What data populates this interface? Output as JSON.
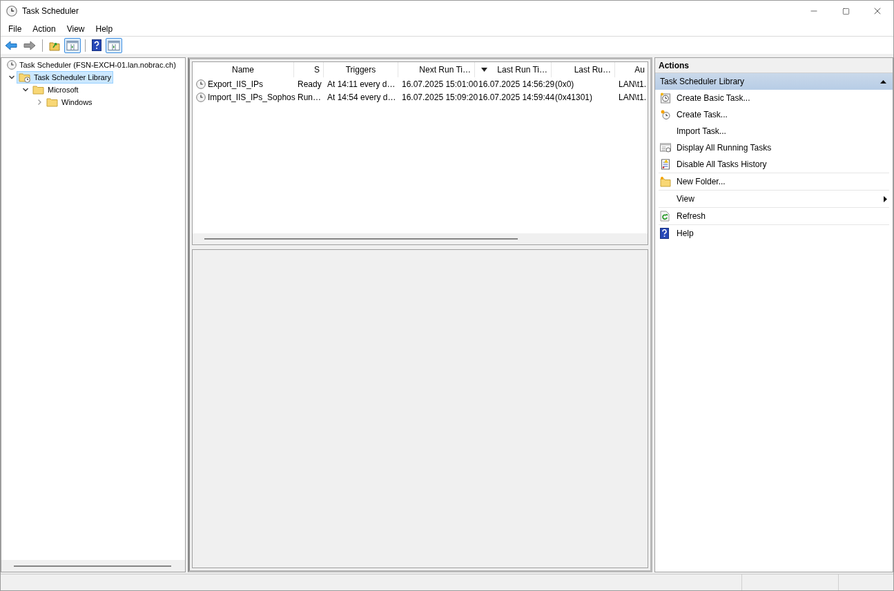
{
  "window": {
    "title": "Task Scheduler"
  },
  "menu": [
    "File",
    "Action",
    "View",
    "Help"
  ],
  "toolbar": [
    {
      "kind": "back",
      "pressed": false
    },
    {
      "kind": "forward",
      "pressed": false
    },
    {
      "kind": "separator"
    },
    {
      "kind": "folder-up",
      "pressed": false
    },
    {
      "kind": "tree-pane",
      "pressed": true
    },
    {
      "kind": "separator"
    },
    {
      "kind": "help",
      "pressed": false
    },
    {
      "kind": "action-pane",
      "pressed": true
    }
  ],
  "tree": [
    {
      "label": "Task Scheduler (FSN-EXCH-01.lan.nobrac.ch)",
      "kind": "clock",
      "selected": false,
      "children": [
        {
          "label": "Task Scheduler Library",
          "kind": "library",
          "selected": true,
          "expanded": true,
          "children": [
            {
              "label": "Microsoft",
              "kind": "folder",
              "selected": false,
              "expanded": true,
              "children": [
                {
                  "label": "Windows",
                  "kind": "folder",
                  "selected": false,
                  "expanded": false
                }
              ]
            }
          ]
        }
      ]
    }
  ],
  "table": {
    "columns": [
      {
        "label": "Name",
        "sorted": false
      },
      {
        "label": "S",
        "sorted": false
      },
      {
        "label": "Triggers",
        "sorted": false
      },
      {
        "label": "Next Run Ti…",
        "sorted": false
      },
      {
        "label": "Last Run Ti…",
        "sorted": true
      },
      {
        "label": "Last Ru…",
        "sorted": false
      },
      {
        "label": "Au",
        "sorted": false
      }
    ],
    "rows": [
      [
        "Export_IIS_IPs",
        "Ready",
        "At 14:11 every d…",
        "16.07.2025 15:01:00",
        "16.07.2025 14:56:29",
        "(0x0)",
        "LAN\\t1."
      ],
      [
        "Import_IIS_IPs_Sophos",
        "Run…",
        "At 14:54 every d…",
        "16.07.2025 15:09:20",
        "16.07.2025 14:59:44",
        "(0x41301)",
        "LAN\\t1."
      ]
    ]
  },
  "actions": {
    "title": "Actions",
    "section": {
      "title": "Task Scheduler Library",
      "expanded": true
    },
    "groups": [
      [
        {
          "label": "Create Basic Task...",
          "kind": "basic-task"
        },
        {
          "label": "Create Task...",
          "kind": "task"
        },
        {
          "label": "Import Task...",
          "kind": "plain"
        },
        {
          "label": "Display All Running Tasks",
          "kind": "running"
        },
        {
          "label": "Disable All Tasks History",
          "kind": "history"
        }
      ],
      [
        {
          "label": "New Folder...",
          "kind": "folder"
        }
      ],
      [
        {
          "label": "View",
          "kind": "submenu"
        }
      ],
      [
        {
          "label": "Refresh",
          "kind": "refresh"
        }
      ],
      [
        {
          "label": "Help",
          "kind": "help"
        }
      ]
    ]
  }
}
